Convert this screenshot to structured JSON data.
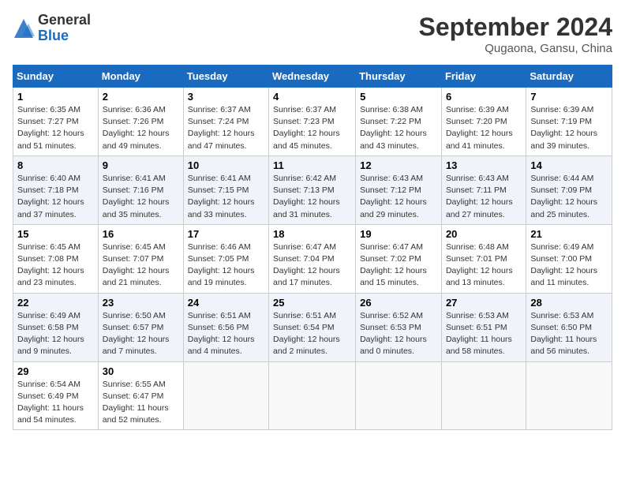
{
  "header": {
    "logo_general": "General",
    "logo_blue": "Blue",
    "month_title": "September 2024",
    "location": "Qugaona, Gansu, China"
  },
  "calendar": {
    "days_of_week": [
      "Sunday",
      "Monday",
      "Tuesday",
      "Wednesday",
      "Thursday",
      "Friday",
      "Saturday"
    ],
    "weeks": [
      [
        {
          "day": "",
          "info": ""
        },
        {
          "day": "2",
          "info": "Sunrise: 6:36 AM\nSunset: 7:26 PM\nDaylight: 12 hours\nand 49 minutes."
        },
        {
          "day": "3",
          "info": "Sunrise: 6:37 AM\nSunset: 7:24 PM\nDaylight: 12 hours\nand 47 minutes."
        },
        {
          "day": "4",
          "info": "Sunrise: 6:37 AM\nSunset: 7:23 PM\nDaylight: 12 hours\nand 45 minutes."
        },
        {
          "day": "5",
          "info": "Sunrise: 6:38 AM\nSunset: 7:22 PM\nDaylight: 12 hours\nand 43 minutes."
        },
        {
          "day": "6",
          "info": "Sunrise: 6:39 AM\nSunset: 7:20 PM\nDaylight: 12 hours\nand 41 minutes."
        },
        {
          "day": "7",
          "info": "Sunrise: 6:39 AM\nSunset: 7:19 PM\nDaylight: 12 hours\nand 39 minutes."
        }
      ],
      [
        {
          "day": "1",
          "info": "Sunrise: 6:35 AM\nSunset: 7:27 PM\nDaylight: 12 hours\nand 51 minutes."
        },
        {
          "day": "8",
          "info": "Sunrise: 6:40 AM\nSunset: 7:18 PM\nDaylight: 12 hours\nand 37 minutes."
        },
        {
          "day": "9",
          "info": "Sunrise: 6:41 AM\nSunset: 7:16 PM\nDaylight: 12 hours\nand 35 minutes."
        },
        {
          "day": "10",
          "info": "Sunrise: 6:41 AM\nSunset: 7:15 PM\nDaylight: 12 hours\nand 33 minutes."
        },
        {
          "day": "11",
          "info": "Sunrise: 6:42 AM\nSunset: 7:13 PM\nDaylight: 12 hours\nand 31 minutes."
        },
        {
          "day": "12",
          "info": "Sunrise: 6:43 AM\nSunset: 7:12 PM\nDaylight: 12 hours\nand 29 minutes."
        },
        {
          "day": "13",
          "info": "Sunrise: 6:43 AM\nSunset: 7:11 PM\nDaylight: 12 hours\nand 27 minutes."
        },
        {
          "day": "14",
          "info": "Sunrise: 6:44 AM\nSunset: 7:09 PM\nDaylight: 12 hours\nand 25 minutes."
        }
      ],
      [
        {
          "day": "15",
          "info": "Sunrise: 6:45 AM\nSunset: 7:08 PM\nDaylight: 12 hours\nand 23 minutes."
        },
        {
          "day": "16",
          "info": "Sunrise: 6:45 AM\nSunset: 7:07 PM\nDaylight: 12 hours\nand 21 minutes."
        },
        {
          "day": "17",
          "info": "Sunrise: 6:46 AM\nSunset: 7:05 PM\nDaylight: 12 hours\nand 19 minutes."
        },
        {
          "day": "18",
          "info": "Sunrise: 6:47 AM\nSunset: 7:04 PM\nDaylight: 12 hours\nand 17 minutes."
        },
        {
          "day": "19",
          "info": "Sunrise: 6:47 AM\nSunset: 7:02 PM\nDaylight: 12 hours\nand 15 minutes."
        },
        {
          "day": "20",
          "info": "Sunrise: 6:48 AM\nSunset: 7:01 PM\nDaylight: 12 hours\nand 13 minutes."
        },
        {
          "day": "21",
          "info": "Sunrise: 6:49 AM\nSunset: 7:00 PM\nDaylight: 12 hours\nand 11 minutes."
        }
      ],
      [
        {
          "day": "22",
          "info": "Sunrise: 6:49 AM\nSunset: 6:58 PM\nDaylight: 12 hours\nand 9 minutes."
        },
        {
          "day": "23",
          "info": "Sunrise: 6:50 AM\nSunset: 6:57 PM\nDaylight: 12 hours\nand 7 minutes."
        },
        {
          "day": "24",
          "info": "Sunrise: 6:51 AM\nSunset: 6:56 PM\nDaylight: 12 hours\nand 4 minutes."
        },
        {
          "day": "25",
          "info": "Sunrise: 6:51 AM\nSunset: 6:54 PM\nDaylight: 12 hours\nand 2 minutes."
        },
        {
          "day": "26",
          "info": "Sunrise: 6:52 AM\nSunset: 6:53 PM\nDaylight: 12 hours\nand 0 minutes."
        },
        {
          "day": "27",
          "info": "Sunrise: 6:53 AM\nSunset: 6:51 PM\nDaylight: 11 hours\nand 58 minutes."
        },
        {
          "day": "28",
          "info": "Sunrise: 6:53 AM\nSunset: 6:50 PM\nDaylight: 11 hours\nand 56 minutes."
        }
      ],
      [
        {
          "day": "29",
          "info": "Sunrise: 6:54 AM\nSunset: 6:49 PM\nDaylight: 11 hours\nand 54 minutes."
        },
        {
          "day": "30",
          "info": "Sunrise: 6:55 AM\nSunset: 6:47 PM\nDaylight: 11 hours\nand 52 minutes."
        },
        {
          "day": "",
          "info": ""
        },
        {
          "day": "",
          "info": ""
        },
        {
          "day": "",
          "info": ""
        },
        {
          "day": "",
          "info": ""
        },
        {
          "day": "",
          "info": ""
        }
      ]
    ]
  }
}
